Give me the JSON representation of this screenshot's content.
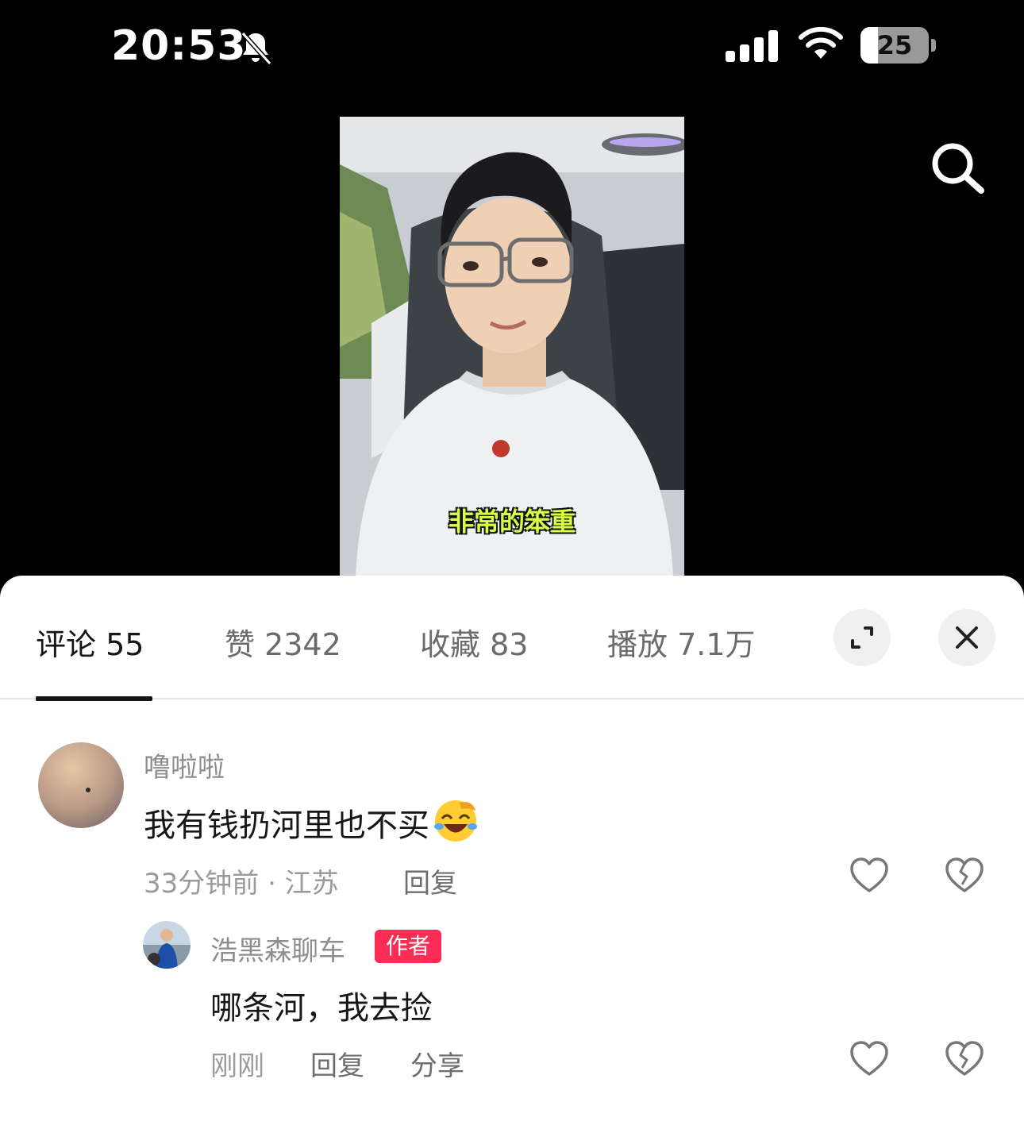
{
  "status_bar": {
    "time": "20:53",
    "battery_level": "25",
    "battery_fraction": 0.25,
    "icons": [
      "bell-slash-icon",
      "cellular-signal-icon",
      "wifi-icon",
      "battery-icon"
    ]
  },
  "video": {
    "caption": "非常的笨重",
    "search_icon": "search-icon"
  },
  "tabs": [
    {
      "label": "评论 55"
    },
    {
      "label": "赞 2342"
    },
    {
      "label": "收藏 83"
    },
    {
      "label": "播放 7.1万"
    }
  ],
  "sheet_buttons": {
    "expand_icon": "expand-icon",
    "close_icon": "close-icon"
  },
  "comments": [
    {
      "username": "噜啦啦",
      "text": "我有钱扔河里也不买",
      "emoji": "laughing-crying-emoji",
      "meta": "33分钟前 · 江苏",
      "reply_label": "回复"
    }
  ],
  "reply": {
    "username": "浩黑森聊车",
    "badge": "作者",
    "text": "哪条河，我去捡",
    "time": "刚刚",
    "reply_label": "回复",
    "share_label": "分享"
  },
  "colors": {
    "accent_badge": "#fe2c55",
    "caption": "#d7ff45"
  }
}
